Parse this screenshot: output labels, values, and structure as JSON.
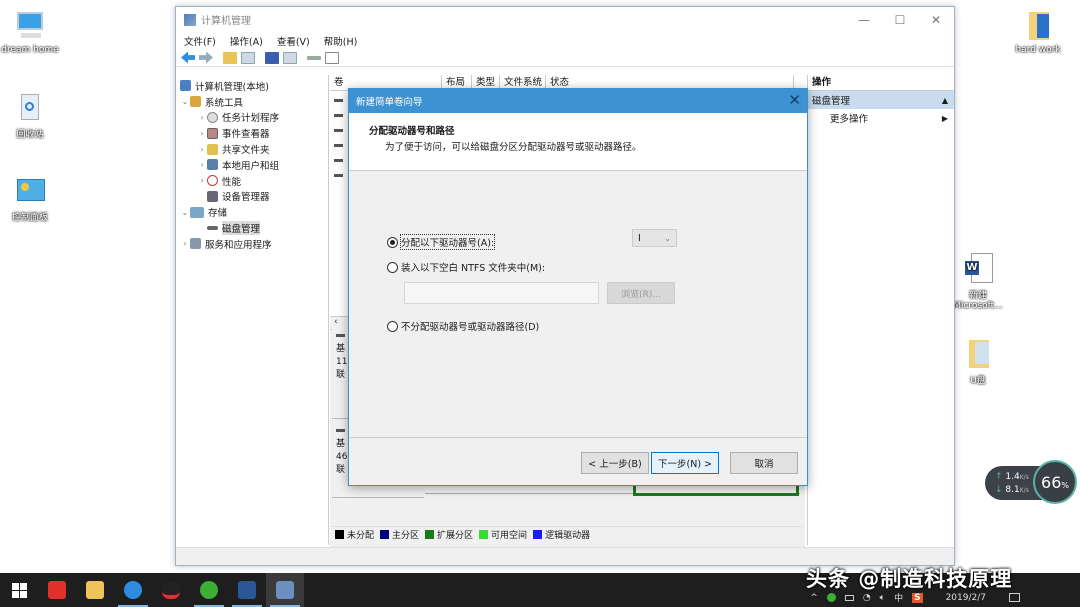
{
  "desktop": {
    "left_icons": [
      {
        "label": "dream home",
        "icon": "computer-icon"
      },
      {
        "label": "回收站",
        "icon": "recycle-bin-icon"
      },
      {
        "label": "控制面板",
        "icon": "control-panel-icon"
      }
    ],
    "right_icons": [
      {
        "label": "hard work",
        "icon": "folder-icon"
      },
      {
        "label": "新建 Microsoft...",
        "icon": "word-document-icon"
      },
      {
        "label": "U盘",
        "icon": "drive-folder-icon"
      }
    ]
  },
  "window": {
    "title": "计算机管理",
    "controls": {
      "minimize": "—",
      "maximize": "☐",
      "close": "✕"
    },
    "menu": [
      "文件(F)",
      "操作(A)",
      "查看(V)",
      "帮助(H)"
    ],
    "toolbar": [
      "back-icon",
      "forward-icon",
      "up-folder-icon",
      "show-hide-tree-icon",
      "help-icon",
      "properties-icon",
      "connect-icon",
      "console-icon"
    ]
  },
  "tree": [
    {
      "label": "计算机管理(本地)",
      "level": 0,
      "arrow": "",
      "icon": "computer-management-icon"
    },
    {
      "label": "系统工具",
      "level": 1,
      "arrow": "⌄",
      "icon": "tools-icon"
    },
    {
      "label": "任务计划程序",
      "level": 2,
      "arrow": "›",
      "icon": "clock-icon"
    },
    {
      "label": "事件查看器",
      "level": 2,
      "arrow": "›",
      "icon": "event-viewer-icon"
    },
    {
      "label": "共享文件夹",
      "level": 2,
      "arrow": "›",
      "icon": "shared-folder-icon"
    },
    {
      "label": "本地用户和组",
      "level": 2,
      "arrow": "›",
      "icon": "users-icon"
    },
    {
      "label": "性能",
      "level": 2,
      "arrow": "›",
      "icon": "performance-icon"
    },
    {
      "label": "设备管理器",
      "level": 2,
      "arrow": "",
      "icon": "device-manager-icon"
    },
    {
      "label": "存储",
      "level": 1,
      "arrow": "⌄",
      "icon": "storage-icon"
    },
    {
      "label": "磁盘管理",
      "level": 2,
      "arrow": "",
      "icon": "disk-icon",
      "selected": true
    },
    {
      "label": "服务和应用程序",
      "level": 1,
      "arrow": "›",
      "icon": "services-icon"
    }
  ],
  "volume_columns": [
    "卷",
    "布局",
    "类型",
    "文件系统",
    "状态"
  ],
  "volume_rows_count": 6,
  "scroll_left": "‹",
  "disks": [
    {
      "line1": "基",
      "line2": "11",
      "line3": "联"
    },
    {
      "line1": "基",
      "line2": "46",
      "line3": "联"
    }
  ],
  "legend": [
    {
      "label": "未分配",
      "color": "#000000"
    },
    {
      "label": "主分区",
      "color": "#000080"
    },
    {
      "label": "扩展分区",
      "color": "#1a7a1a"
    },
    {
      "label": "可用空间",
      "color": "#33dd33"
    },
    {
      "label": "逻辑驱动器",
      "color": "#1a1aff"
    }
  ],
  "actions": {
    "header": "操作",
    "section": "磁盘管理",
    "section_arrow": "▲",
    "more": "更多操作",
    "more_arrow": "▶"
  },
  "dialog": {
    "title": "新建简单卷向导",
    "close": "✕",
    "heading": "分配驱动器号和路径",
    "subheading": "为了便于访问，可以给磁盘分区分配驱动器号或驱动器路径。",
    "options": [
      {
        "label": "分配以下驱动器号(A):",
        "checked": true
      },
      {
        "label": "装入以下空白 NTFS 文件夹中(M):",
        "checked": false
      },
      {
        "label": "不分配驱动器号或驱动器路径(D)",
        "checked": false
      }
    ],
    "drive_letter": "I",
    "path_value": "",
    "browse": "浏览(R)...",
    "back": "< 上一步(B)",
    "next": "下一步(N) >",
    "cancel": "取消"
  },
  "speed_widget": {
    "up": "1.4",
    "up_unit": "K/s",
    "down": "8.1",
    "down_unit": "K/s",
    "percent": "66",
    "percent_unit": "%"
  },
  "taskbar": {
    "apps": [
      {
        "name": "start-button",
        "color": "#ffffff"
      },
      {
        "name": "netease-music-icon",
        "color": "#e0312b"
      },
      {
        "name": "file-explorer-icon",
        "color": "#f0c35a"
      },
      {
        "name": "browser-icon",
        "color": "#2c8de0"
      },
      {
        "name": "qq-icon",
        "color": "#222222"
      },
      {
        "name": "wechat-icon",
        "color": "#3cb034"
      },
      {
        "name": "word-icon",
        "color": "#2b5797"
      },
      {
        "name": "computer-management-icon",
        "color": "#6a8fc0"
      }
    ],
    "tray": [
      "^",
      "中",
      "S"
    ],
    "date": "2019/2/7"
  },
  "watermark": "头条 @制造科技原理"
}
